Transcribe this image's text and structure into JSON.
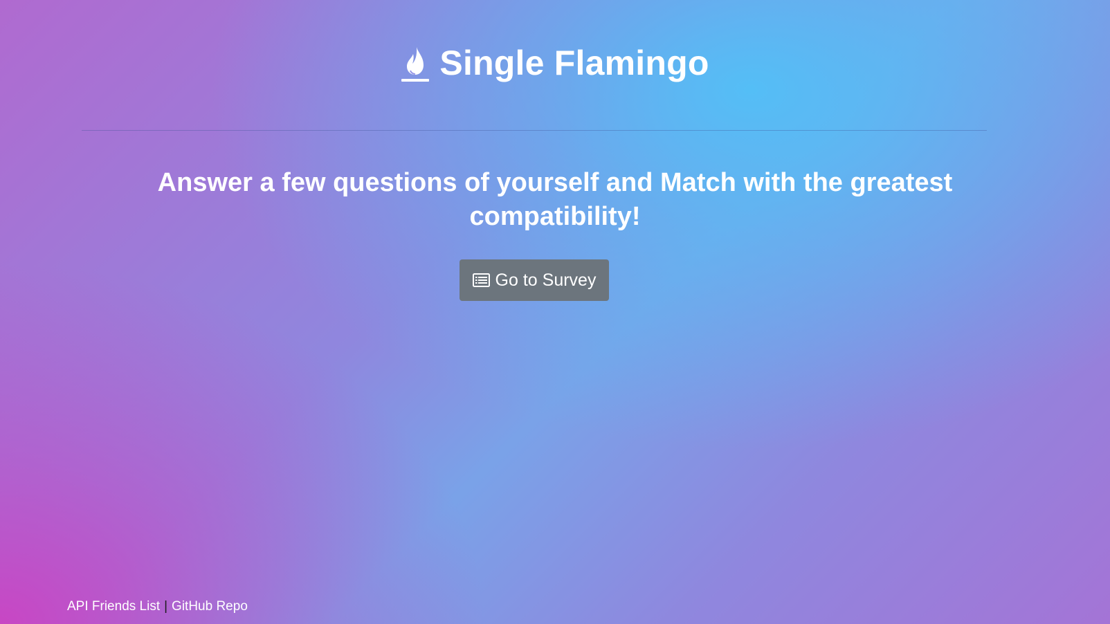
{
  "header": {
    "logo_icon": "flame-icon",
    "title": "Single Flamingo"
  },
  "main": {
    "tagline": "Answer a few questions of yourself and Match with the greatest compatibility!",
    "survey_button": {
      "icon": "list-icon",
      "label": "Go to Survey",
      "color": "#6c757d"
    }
  },
  "footer": {
    "links": [
      {
        "label": "API Friends List"
      },
      {
        "label": "GitHub Repo"
      }
    ],
    "separator": "|"
  },
  "colors": {
    "gradient_blue": "#54bef6",
    "gradient_purple": "#8f87de",
    "gradient_magenta": "#c846c4",
    "text": "#ffffff"
  }
}
